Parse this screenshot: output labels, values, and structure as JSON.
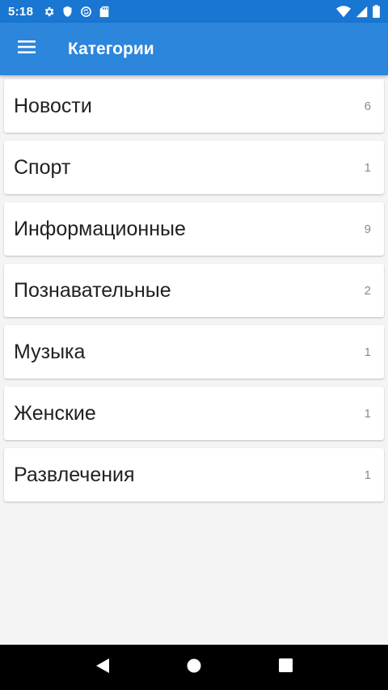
{
  "status_bar": {
    "time": "5:18",
    "left_icons": [
      "gear-icon",
      "shield-icon",
      "sync-icon",
      "sd-card-icon"
    ],
    "right_icons": [
      "wifi-icon",
      "cellular-signal-icon",
      "battery-icon"
    ]
  },
  "app_bar": {
    "title": "Категории",
    "menu_icon": "hamburger-menu-icon",
    "background": "#2b86dc"
  },
  "categories": [
    {
      "name": "Новости",
      "count": "6"
    },
    {
      "name": "Спорт",
      "count": "1"
    },
    {
      "name": "Информационные",
      "count": "9"
    },
    {
      "name": "Познавательные",
      "count": "2"
    },
    {
      "name": "Музыка",
      "count": "1"
    },
    {
      "name": "Женские",
      "count": "1"
    },
    {
      "name": "Развлечения",
      "count": "1"
    }
  ],
  "nav_bar": {
    "buttons": [
      "back-icon",
      "home-icon",
      "recents-icon"
    ]
  }
}
